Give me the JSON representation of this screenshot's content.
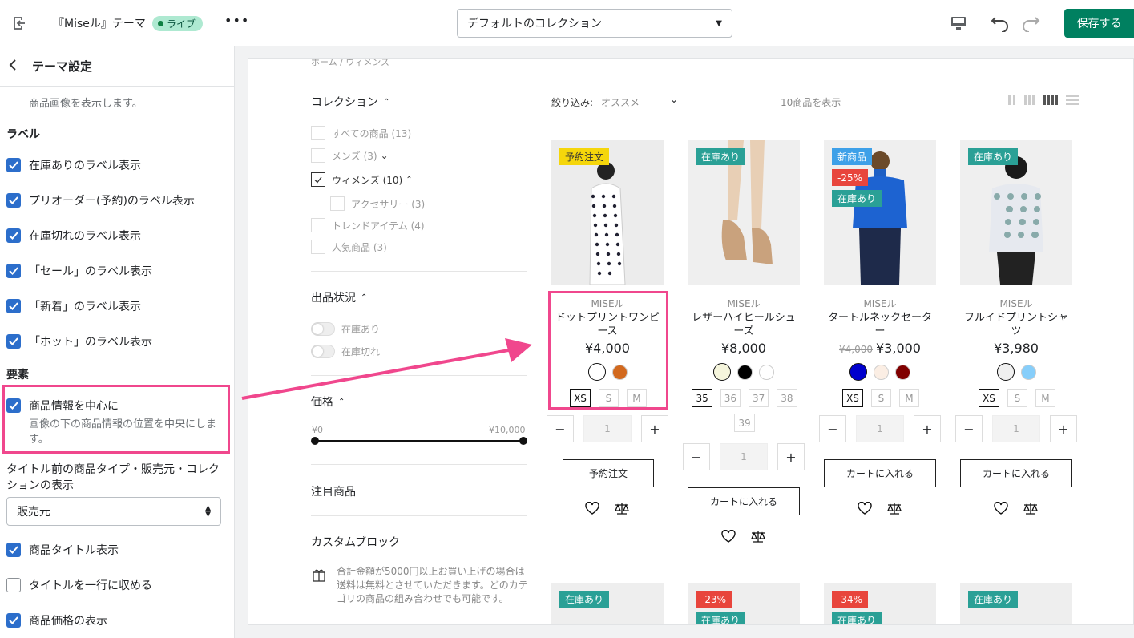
{
  "topbar": {
    "theme_name": "『Miseル』テーマ",
    "live_badge": "ライブ",
    "more": "•••",
    "collection_select": "デフォルトのコレクション",
    "save": "保存する"
  },
  "sidebar": {
    "title": "テーマ設定",
    "desc_top": "商品画像を表示します。",
    "label_section": "ラベル",
    "labels": [
      "在庫ありのラベル表示",
      "プリオーダー(予約)のラベル表示",
      "在庫切れのラベル表示",
      "「セール」のラベル表示",
      "「新着」のラベル表示",
      "「ホット」のラベル表示"
    ],
    "element_section": "要素",
    "center_info": "商品情報を中心に",
    "center_desc": "画像の下の商品情報の位置を中央にします。",
    "prefix_label": "タイトル前の商品タイプ・販売元・コレクションの表示",
    "vendor_select": "販売元",
    "show_title": "商品タイトル表示",
    "one_line": "タイトルを一行に収める",
    "show_price": "商品価格の表示"
  },
  "preview": {
    "breadcrumb": "ホーム / ウィメンズ",
    "collection_title": "コレクション",
    "collections": {
      "all": "すべての商品 (13)",
      "mens": "メンズ (3)",
      "womens": "ウィメンズ (10)",
      "accessory": "アクセサリー (3)",
      "trend": "トレンドアイテム (4)",
      "popular": "人気商品 (3)"
    },
    "availability_title": "出品状況",
    "in_stock": "在庫あり",
    "out_stock": "在庫切れ",
    "price_title": "価格",
    "price_min": "¥0",
    "price_max": "¥10,000",
    "featured_title": "注目商品",
    "custom_title": "カスタムブロック",
    "custom_text": "合計金額が5000円以上お買い上げの場合は送料は無料とさせていただきます。どのカテゴリの商品の組み合わせでも可能です。",
    "sort_label": "絞り込み:",
    "sort_value": "オススメ",
    "count": "10商品を表示",
    "products": [
      {
        "labels": [
          {
            "t": "予約注文",
            "c": "#f5d60b",
            "fg": "#333"
          }
        ],
        "vendor": "MISEル",
        "name": "ドットプリントワンピース",
        "price": "¥4,000",
        "compare": "",
        "swatches": [
          "#ffffff",
          "#d2691e"
        ],
        "sizes": [
          "XS",
          "S",
          "M"
        ],
        "qty": "1",
        "button": "予約注文"
      },
      {
        "labels": [
          {
            "t": "在庫あり",
            "c": "#2aa096",
            "fg": "#fff"
          }
        ],
        "vendor": "MISEル",
        "name": "レザーハイヒールシューズ",
        "price": "¥8,000",
        "compare": "",
        "swatches": [
          "#f5f5dc",
          "#000000",
          "#ffffff"
        ],
        "sizes": [
          "35",
          "36",
          "37",
          "38",
          "39"
        ],
        "qty": "1",
        "button": "カートに入れる"
      },
      {
        "labels": [
          {
            "t": "新商品",
            "c": "#3ea0e8",
            "fg": "#fff"
          },
          {
            "t": "-25%",
            "c": "#e8453c",
            "fg": "#fff"
          },
          {
            "t": "在庫あり",
            "c": "#2aa096",
            "fg": "#fff"
          }
        ],
        "vendor": "MISEル",
        "name": "タートルネックセーター",
        "price": "¥3,000",
        "compare": "¥4,000",
        "swatches": [
          "#0000cd",
          "#fbeee4",
          "#800000"
        ],
        "sizes": [
          "XS",
          "S",
          "M"
        ],
        "qty": "1",
        "button": "カートに入れる"
      },
      {
        "labels": [
          {
            "t": "在庫あり",
            "c": "#2aa096",
            "fg": "#fff"
          }
        ],
        "vendor": "MISEル",
        "name": "フルイドプリントシャツ",
        "price": "¥3,980",
        "compare": "",
        "swatches": [
          "#f0f0f0",
          "#87cefa"
        ],
        "sizes": [
          "XS",
          "S",
          "M"
        ],
        "qty": "1",
        "button": "カートに入れる"
      }
    ],
    "row2_labels": [
      [
        {
          "t": "在庫あり",
          "c": "#2aa096"
        }
      ],
      [
        {
          "t": "-23%",
          "c": "#e8453c"
        },
        {
          "t": "在庫あり",
          "c": "#2aa096"
        }
      ],
      [
        {
          "t": "-34%",
          "c": "#e8453c"
        },
        {
          "t": "在庫あり",
          "c": "#2aa096"
        }
      ],
      [
        {
          "t": "在庫あり",
          "c": "#2aa096"
        }
      ]
    ]
  },
  "icons": {
    "exit": "exit-icon",
    "device": "desktop-icon",
    "undo": "undo-icon",
    "redo": "redo-icon",
    "wishlist": "heart-icon",
    "compare": "scale-icon"
  }
}
